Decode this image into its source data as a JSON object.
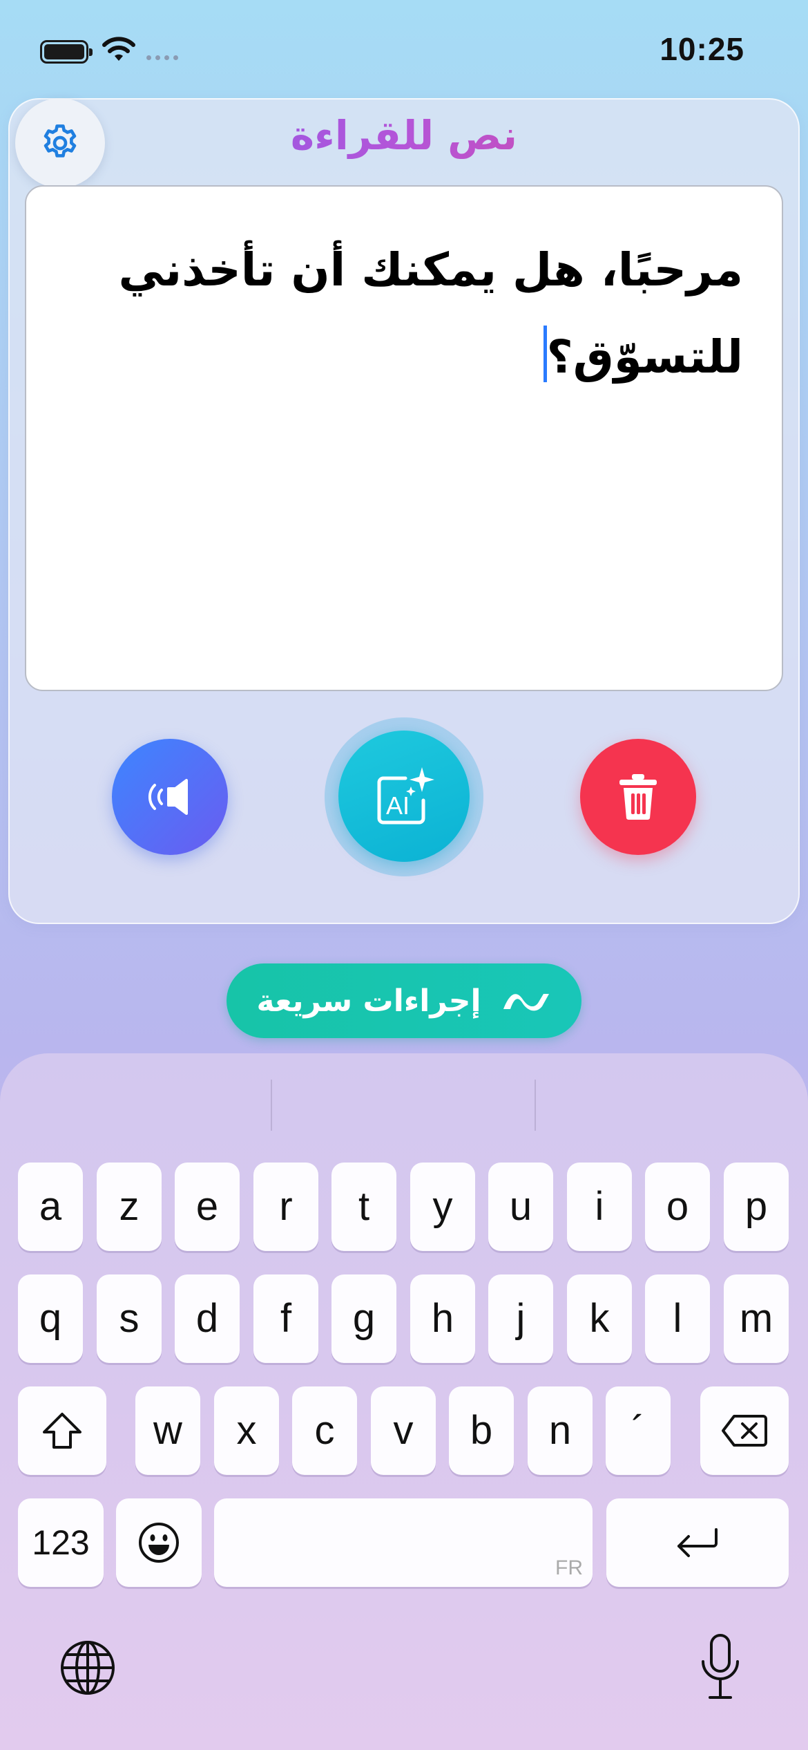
{
  "status_bar": {
    "time": "10:25",
    "icons": [
      "battery-icon",
      "wifi-icon",
      "signal-dots-icon"
    ]
  },
  "card": {
    "title": "نص للقراءة",
    "text_lines": [
      "مرحبًا، هل يمكنك أن تأخذني",
      "للتسوّق؟"
    ],
    "settings_icon": "gear-icon",
    "buttons": {
      "speak_icon": "speaker-icon",
      "ai_icon": "ai-sparkle-icon",
      "delete_icon": "trash-icon"
    }
  },
  "quick_actions": {
    "label": "إجراءات سريعة",
    "icon": "wave-icon"
  },
  "keyboard": {
    "rows": [
      [
        "a",
        "z",
        "e",
        "r",
        "t",
        "y",
        "u",
        "i",
        "o",
        "p"
      ],
      [
        "q",
        "s",
        "d",
        "f",
        "g",
        "h",
        "j",
        "k",
        "l",
        "m"
      ],
      [
        "w",
        "x",
        "c",
        "v",
        "b",
        "n",
        "´"
      ]
    ],
    "numbers_label": "123",
    "space_language": "FR",
    "icons": [
      "shift-icon",
      "backspace-icon",
      "emoji-icon",
      "return-icon",
      "globe-icon",
      "microphone-icon"
    ]
  },
  "colors": {
    "accent_blue": "#2a7bff",
    "speak_gradient": [
      "#3d86ff",
      "#6a5cf0"
    ],
    "ai_cyan": "#14bdd8",
    "delete_red": "#f5344f",
    "quick_actions_teal": "#17c4a8"
  }
}
